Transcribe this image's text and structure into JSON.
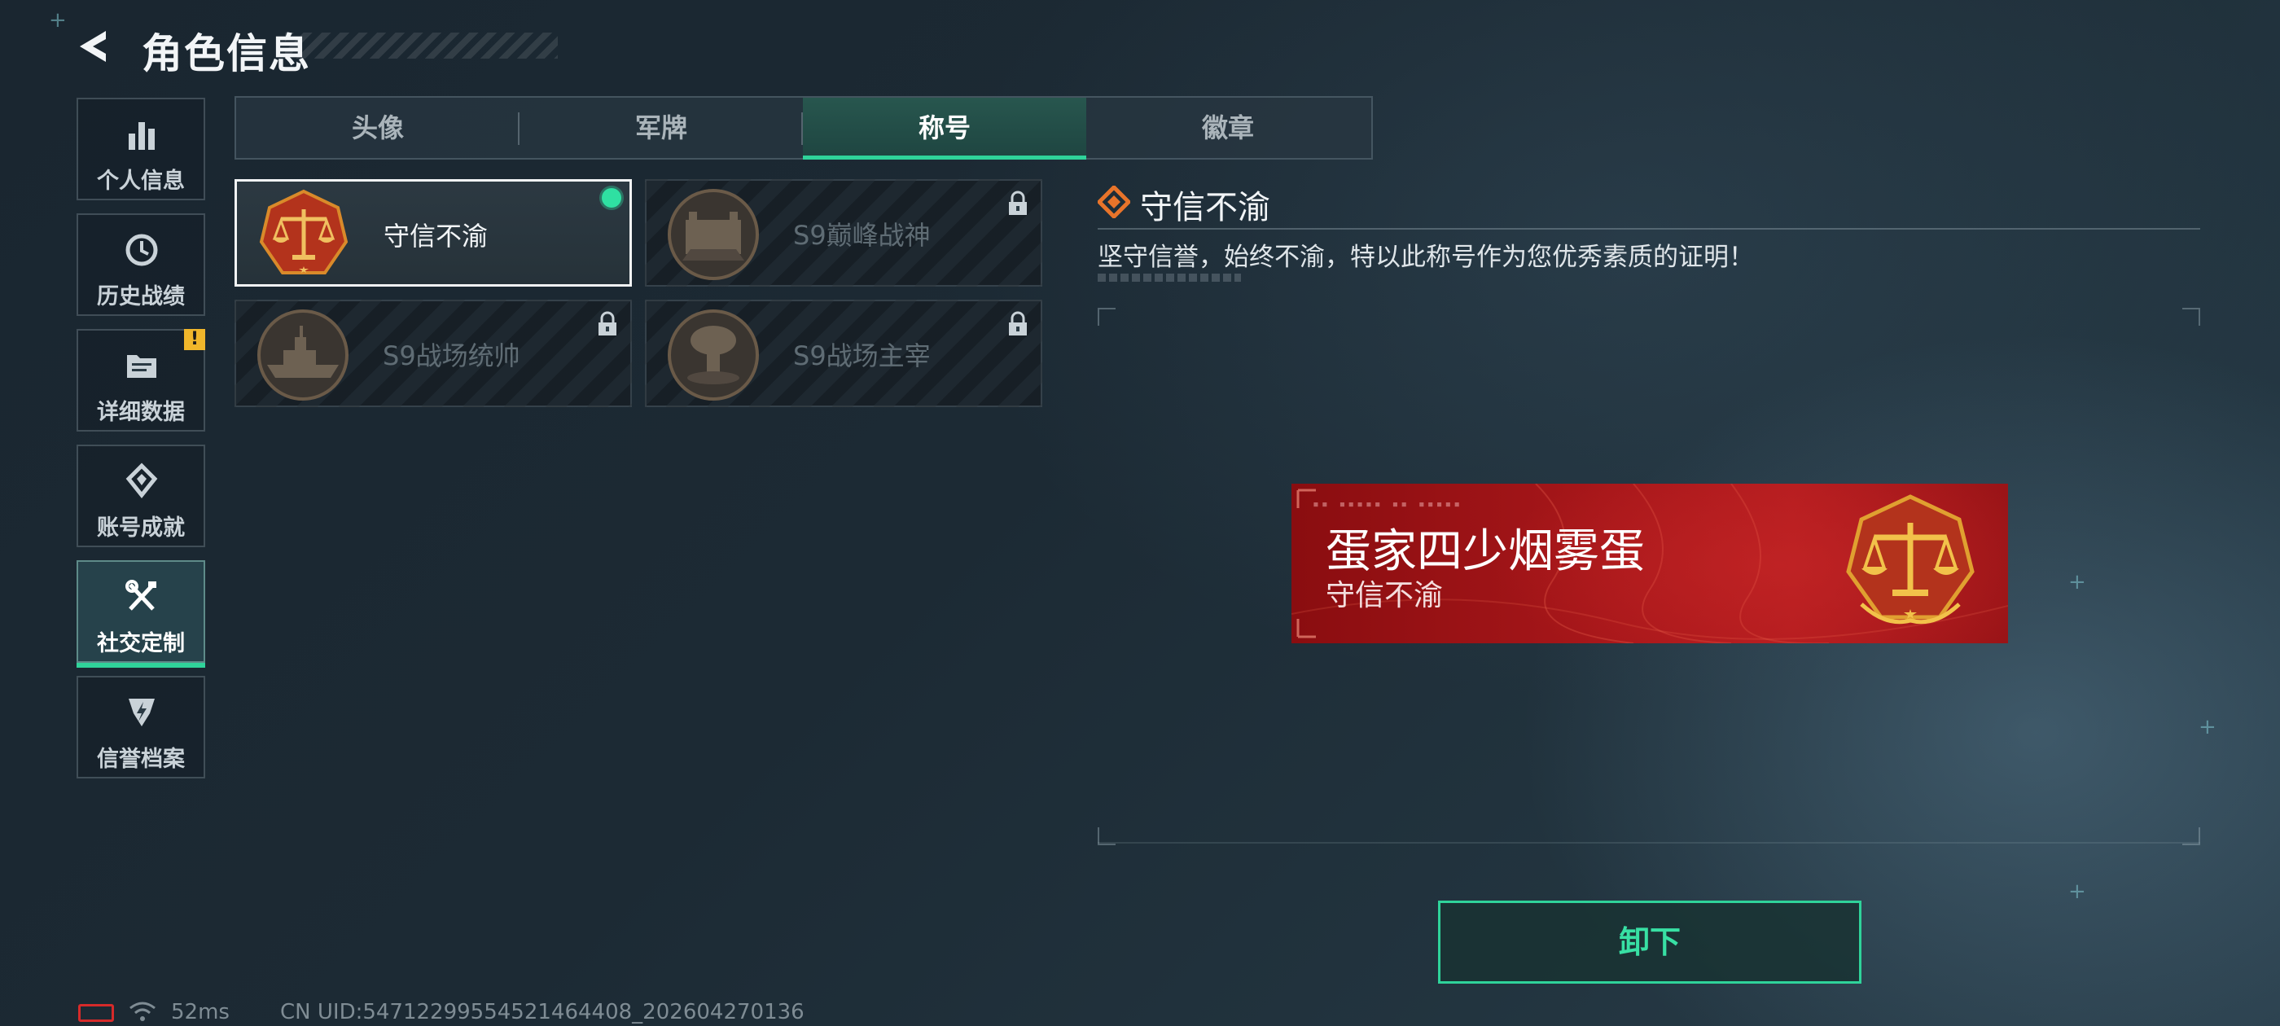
{
  "header": {
    "title": "角色信息"
  },
  "sidebar": {
    "items": [
      {
        "label": "个人信息",
        "icon": "bar-chart-icon",
        "active": false
      },
      {
        "label": "历史战绩",
        "icon": "history-clock-icon",
        "active": false
      },
      {
        "label": "详细数据",
        "icon": "folder-data-icon",
        "active": false,
        "badge": "!"
      },
      {
        "label": "账号成就",
        "icon": "achievement-icon",
        "active": false
      },
      {
        "label": "社交定制",
        "icon": "tools-wrench-icon",
        "active": true
      },
      {
        "label": "信誉档案",
        "icon": "credit-shield-icon",
        "active": false
      }
    ]
  },
  "tabs": [
    {
      "label": "头像",
      "active": false
    },
    {
      "label": "军牌",
      "active": false
    },
    {
      "label": "称号",
      "active": true
    },
    {
      "label": "徽章",
      "active": false
    }
  ],
  "titles": [
    {
      "name": "守信不渝",
      "state": "equipped"
    },
    {
      "name": "S9巅峰战神",
      "state": "locked"
    },
    {
      "name": "S9战场统帅",
      "state": "locked"
    },
    {
      "name": "S9战场主宰",
      "state": "locked"
    }
  ],
  "detail": {
    "title": "守信不渝",
    "description": "坚守信誉，始终不渝，特以此称号作为您优秀素质的证明！"
  },
  "preview": {
    "player_name": "蛋家四少烟雾蛋",
    "title_text": "守信不渝"
  },
  "actions": {
    "unequip_label": "卸下"
  },
  "status": {
    "ping": "52ms",
    "uid": "CN UID:54712299554521464408_202604270136"
  },
  "colors": {
    "accent": "#2fd39a",
    "banner_red": "#a8171a",
    "warning": "#f0b62b",
    "detail_icon": "#e8742a"
  }
}
